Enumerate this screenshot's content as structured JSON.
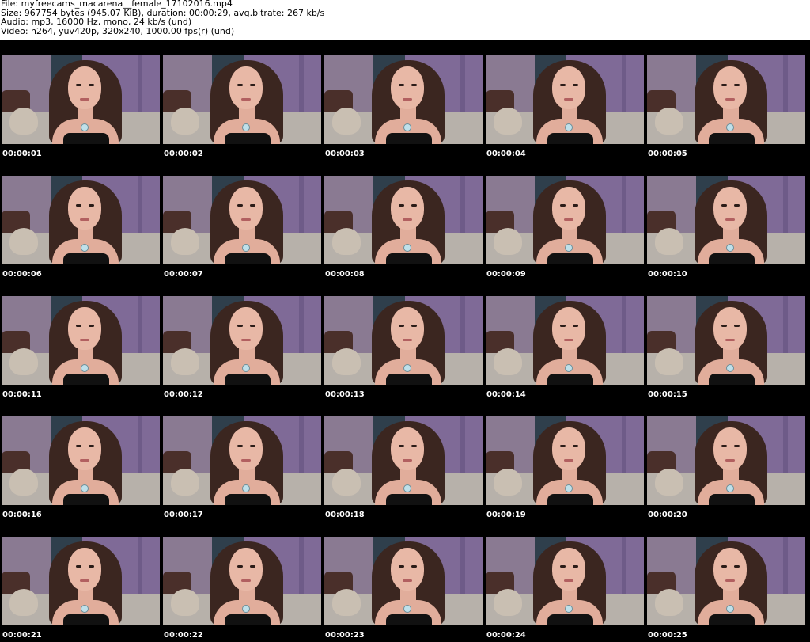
{
  "header": {
    "file_line": "File: myfreecams_macarena__female_17102016.mp4",
    "size_line": "Size: 967754 bytes (945.07 KiB), duration: 00:00:29, avg.bitrate: 267 kb/s",
    "audio_line": "Audio: mp3, 16000 Hz, mono, 24 kb/s (und)",
    "video_line": "Video: h264, yuv420p, 320x240, 1000.00 fps(r) (und)"
  },
  "thumbnails": [
    {
      "time": "00:00:01"
    },
    {
      "time": "00:00:02"
    },
    {
      "time": "00:00:03"
    },
    {
      "time": "00:00:04"
    },
    {
      "time": "00:00:05"
    },
    {
      "time": "00:00:06"
    },
    {
      "time": "00:00:07"
    },
    {
      "time": "00:00:08"
    },
    {
      "time": "00:00:09"
    },
    {
      "time": "00:00:10"
    },
    {
      "time": "00:00:11"
    },
    {
      "time": "00:00:12"
    },
    {
      "time": "00:00:13"
    },
    {
      "time": "00:00:14"
    },
    {
      "time": "00:00:15"
    },
    {
      "time": "00:00:16"
    },
    {
      "time": "00:00:17"
    },
    {
      "time": "00:00:18"
    },
    {
      "time": "00:00:19"
    },
    {
      "time": "00:00:20"
    },
    {
      "time": "00:00:21"
    },
    {
      "time": "00:00:22"
    },
    {
      "time": "00:00:23"
    },
    {
      "time": "00:00:24"
    },
    {
      "time": "00:00:25"
    }
  ],
  "colors": {
    "background": "#ffffff",
    "grid_background": "#000000",
    "timestamp_text": "#ffffff"
  }
}
